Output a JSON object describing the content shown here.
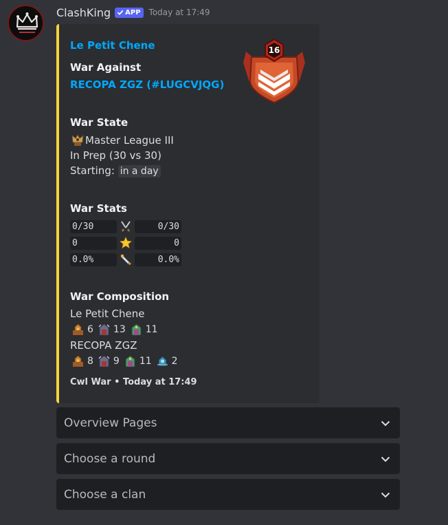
{
  "message": {
    "author": "ClashKing",
    "badge": "APP",
    "timestamp": "Today at 17:49"
  },
  "embed": {
    "accent_color": "#f4d43b",
    "author_link": "Le Petit Chene",
    "war_against_label": "War Against",
    "opponent_link": "RECOPA ZGZ (#LUGCVJQG)",
    "thumbnail": {
      "icon": "clan-badge-icon",
      "level": "16"
    },
    "war_state": {
      "label": "War State",
      "league": "Master League III",
      "status": "In Prep (30 vs 30)",
      "starting_label": "Starting:",
      "starting_value": "in a day"
    },
    "war_stats": {
      "label": "War Stats",
      "rows": [
        {
          "left": "0/30",
          "icon": "swords-icon",
          "right": "0/30"
        },
        {
          "left": "0",
          "icon": "star-icon",
          "right": "0"
        },
        {
          "left": "0.0%",
          "icon": "destruction-icon",
          "right": "0.0%"
        }
      ]
    },
    "war_composition": {
      "label": "War Composition",
      "clan1": {
        "name": "Le Petit Chene",
        "townhalls": [
          {
            "icon": "townhall-icon",
            "count": "6"
          },
          {
            "icon": "townhall-icon",
            "count": "13"
          },
          {
            "icon": "townhall-icon",
            "count": "11"
          }
        ]
      },
      "clan2": {
        "name": "RECOPA ZGZ",
        "townhalls": [
          {
            "icon": "townhall-icon",
            "count": "8"
          },
          {
            "icon": "townhall-icon",
            "count": "9"
          },
          {
            "icon": "townhall-icon",
            "count": "11"
          },
          {
            "icon": "townhall-icon",
            "count": "2"
          }
        ]
      }
    },
    "footer": "Cwl War • Today at 17:49"
  },
  "selects": [
    {
      "label": "Overview Pages"
    },
    {
      "label": "Choose a round"
    },
    {
      "label": "Choose a clan"
    }
  ]
}
